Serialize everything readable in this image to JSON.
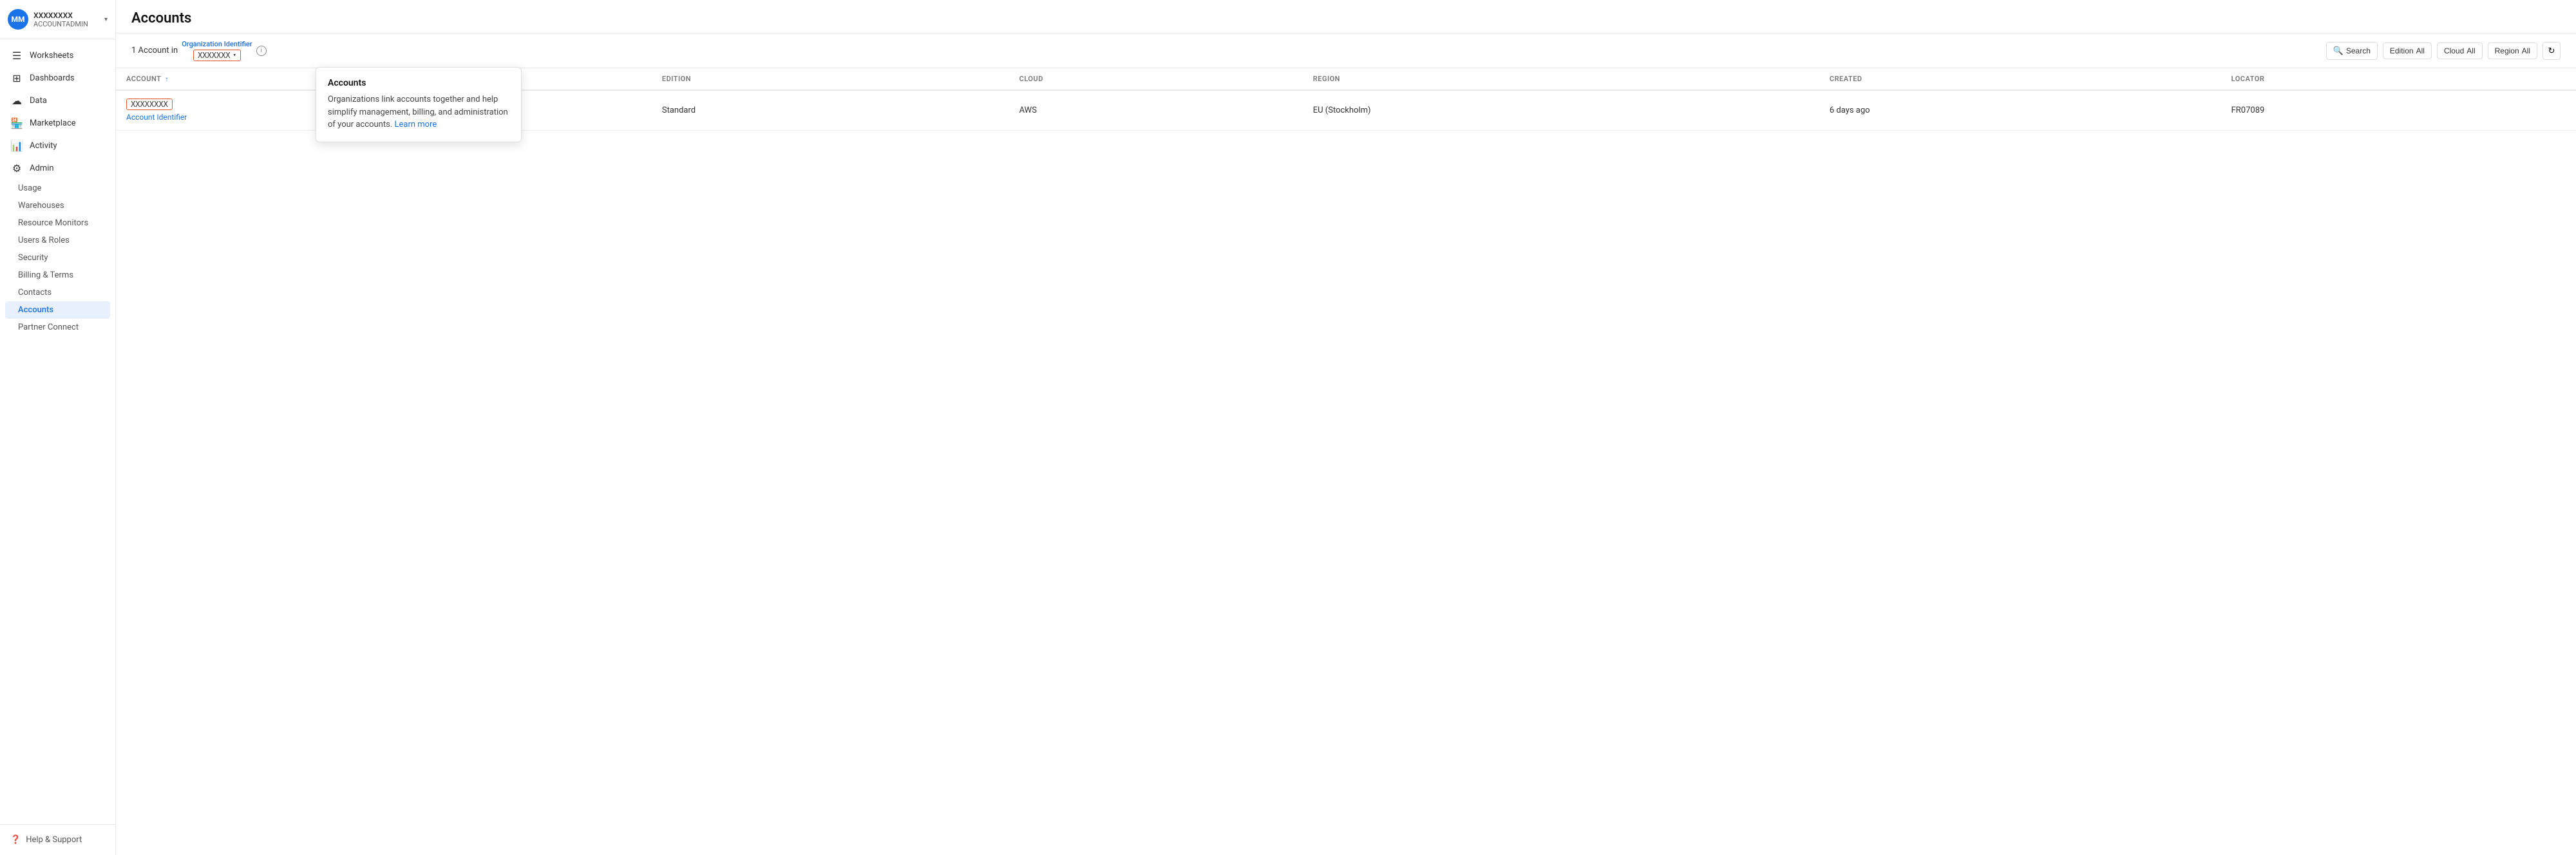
{
  "sidebar": {
    "user": {
      "initials": "MM",
      "username": "XXXXXXXX",
      "role": "ACCOUNTADMIN"
    },
    "nav_items": [
      {
        "id": "worksheets",
        "label": "Worksheets",
        "icon": "📄"
      },
      {
        "id": "dashboards",
        "label": "Dashboards",
        "icon": "⊞"
      },
      {
        "id": "data",
        "label": "Data",
        "icon": "☁"
      },
      {
        "id": "marketplace",
        "label": "Marketplace",
        "icon": "🏪"
      },
      {
        "id": "activity",
        "label": "Activity",
        "icon": "📊"
      },
      {
        "id": "admin",
        "label": "Admin",
        "icon": "⚙"
      }
    ],
    "admin_sub_items": [
      {
        "id": "usage",
        "label": "Usage"
      },
      {
        "id": "warehouses",
        "label": "Warehouses"
      },
      {
        "id": "resource-monitors",
        "label": "Resource Monitors"
      },
      {
        "id": "users-roles",
        "label": "Users & Roles"
      },
      {
        "id": "security",
        "label": "Security"
      },
      {
        "id": "billing-terms",
        "label": "Billing & Terms"
      },
      {
        "id": "contacts",
        "label": "Contacts"
      },
      {
        "id": "accounts",
        "label": "Accounts"
      },
      {
        "id": "partner-connect",
        "label": "Partner Connect"
      }
    ],
    "footer": {
      "help_label": "Help & Support"
    }
  },
  "main": {
    "page_title": "Accounts",
    "account_count_text": "1 Account in",
    "org_id": "XXXXXXX",
    "org_id_label": "Organization Identifier",
    "table": {
      "columns": [
        {
          "id": "account",
          "label": "ACCOUNT",
          "sortable": true,
          "sort_dir": "asc"
        },
        {
          "id": "edition",
          "label": "EDITION"
        },
        {
          "id": "cloud",
          "label": "CLOUD"
        },
        {
          "id": "region",
          "label": "REGION"
        },
        {
          "id": "created",
          "label": "CREATED"
        },
        {
          "id": "locator",
          "label": "LOCATOR"
        }
      ],
      "rows": [
        {
          "account": "XXXXXXXX",
          "edition": "Standard",
          "cloud": "AWS",
          "region": "EU (Stockholm)",
          "created": "6 days ago",
          "locator": "FR07089"
        }
      ],
      "account_identifier_label": "Account Identifier"
    },
    "toolbar": {
      "search_label": "Search",
      "edition_label": "Edition",
      "edition_value": "All",
      "cloud_label": "Cloud",
      "cloud_value": "All",
      "region_label": "Region",
      "region_value": "All"
    },
    "popover": {
      "title": "Accounts",
      "text": "Organizations link accounts together and help simplify management, billing, and administration of your accounts.",
      "link_text": "Learn more"
    }
  }
}
